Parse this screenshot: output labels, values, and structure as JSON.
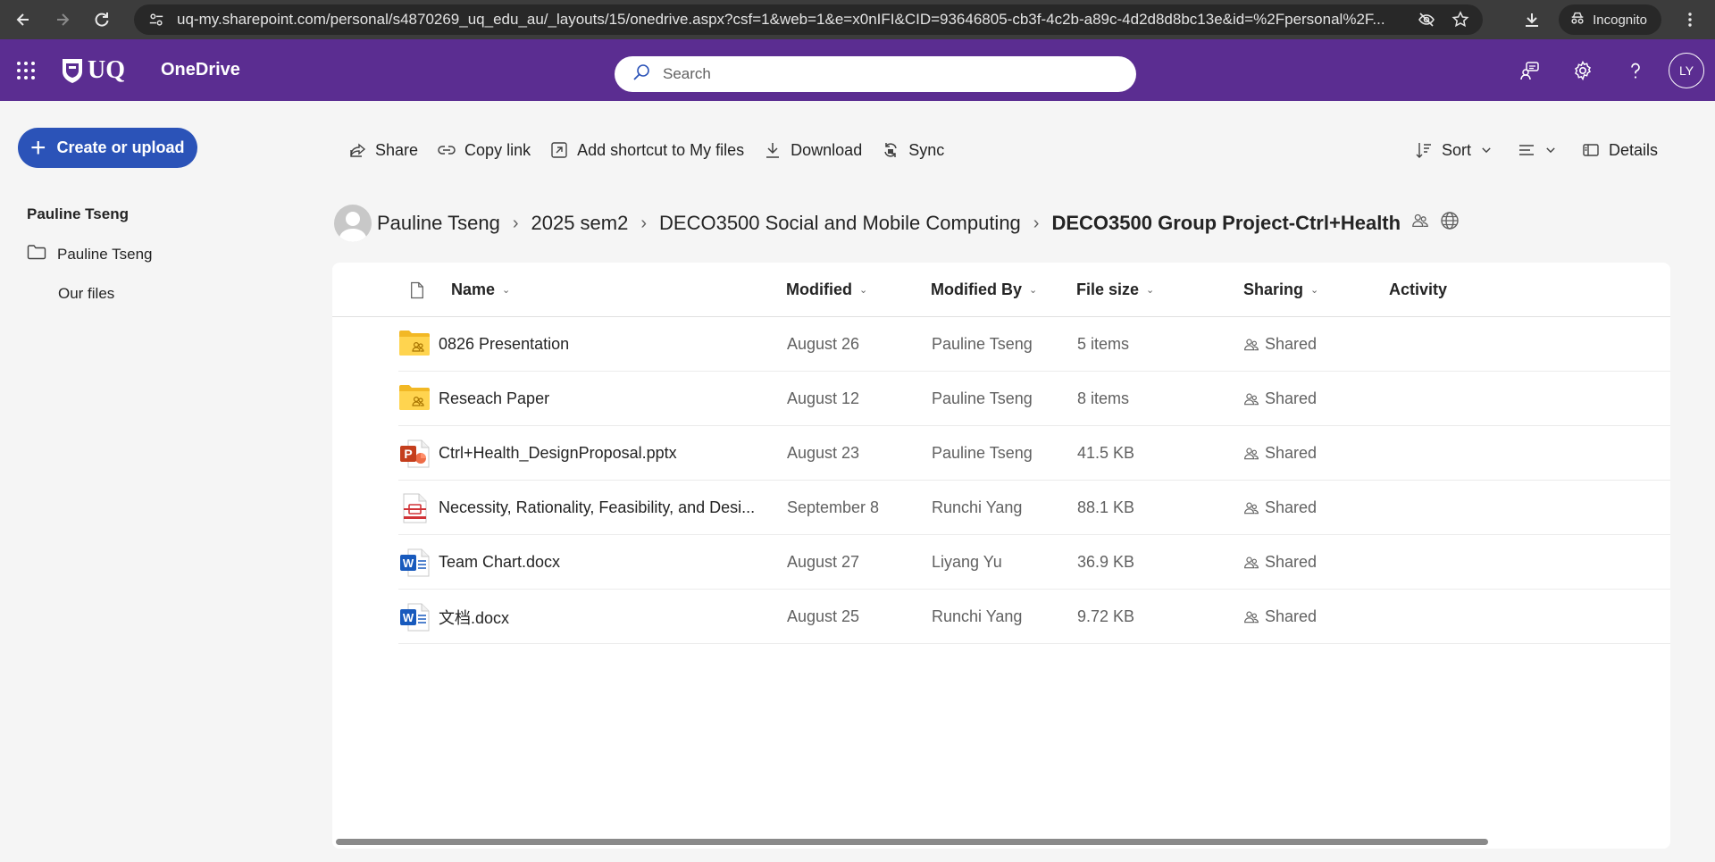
{
  "browser": {
    "url": "uq-my.sharepoint.com/personal/s4870269_uq_edu_au/_layouts/15/onedrive.aspx?csf=1&web=1&e=x0nIFI&CID=93646805-cb3f-4c2b-a89c-4d2d8d8bc13e&id=%2Fpersonal%2F...",
    "incognito_label": "Incognito"
  },
  "suite": {
    "logo_text": "UQ",
    "app_name": "OneDrive",
    "search_placeholder": "Search",
    "avatar_initials": "LY",
    "color": "#5b2d91"
  },
  "leftnav": {
    "create_label": "Create or upload",
    "heading": "Pauline Tseng",
    "items": [
      {
        "label": "Pauline Tseng",
        "icon": "folder-icon"
      },
      {
        "label": "Our files"
      }
    ]
  },
  "commandbar": {
    "share": "Share",
    "copy_link": "Copy link",
    "add_shortcut": "Add shortcut to My files",
    "download": "Download",
    "sync": "Sync",
    "sort": "Sort",
    "details": "Details"
  },
  "breadcrumb": {
    "items": [
      "Pauline Tseng",
      "2025 sem2",
      "DECO3500 Social and Mobile Computing"
    ],
    "current": "DECO3500 Group Project-Ctrl+Health"
  },
  "table": {
    "columns": {
      "name": "Name",
      "modified": "Modified",
      "modified_by": "Modified By",
      "file_size": "File size",
      "sharing": "Sharing",
      "activity": "Activity"
    },
    "rows": [
      {
        "type": "shared-folder-icon",
        "name": "0826 Presentation",
        "modified": "August 26",
        "modified_by": "Pauline Tseng",
        "size": "5 items",
        "sharing": "Shared"
      },
      {
        "type": "shared-folder-icon",
        "name": "Reseach Paper",
        "modified": "August 12",
        "modified_by": "Pauline Tseng",
        "size": "8 items",
        "sharing": "Shared"
      },
      {
        "type": "powerpoint-icon",
        "name": "Ctrl+Health_DesignProposal.pptx",
        "modified": "August 23",
        "modified_by": "Pauline Tseng",
        "size": "41.5 KB",
        "sharing": "Shared"
      },
      {
        "type": "pdf-icon",
        "name": "Necessity, Rationality, Feasibility, and Desi...",
        "modified": "September 8",
        "modified_by": "Runchi Yang",
        "size": "88.1 KB",
        "sharing": "Shared"
      },
      {
        "type": "word-icon",
        "name": "Team Chart.docx",
        "modified": "August 27",
        "modified_by": "Liyang Yu",
        "size": "36.9 KB",
        "sharing": "Shared"
      },
      {
        "type": "word-icon",
        "name": "文档.docx",
        "modified": "August 25",
        "modified_by": "Runchi Yang",
        "size": "9.72 KB",
        "sharing": "Shared"
      }
    ]
  }
}
